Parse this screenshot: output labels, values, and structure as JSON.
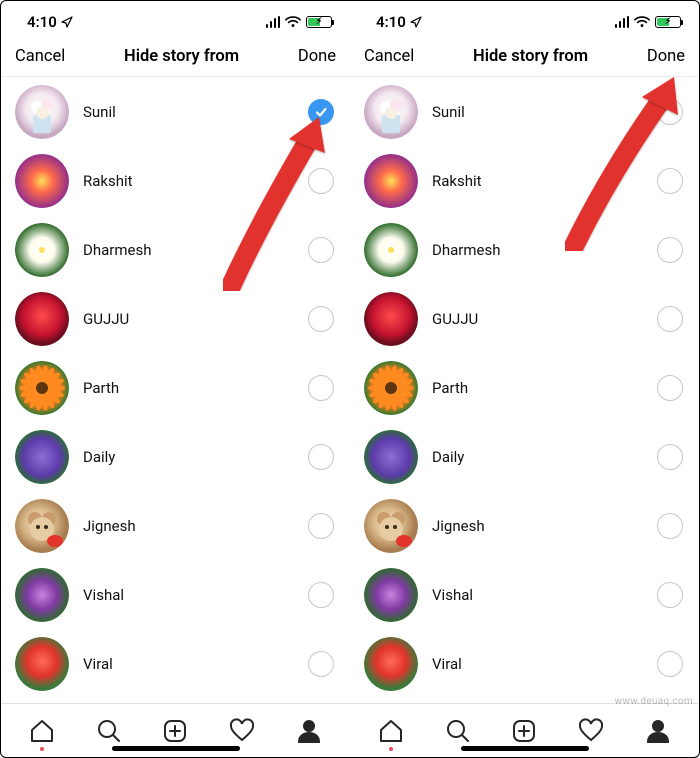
{
  "status": {
    "time": "4:10",
    "location_icon": "location-arrow"
  },
  "header": {
    "cancel": "Cancel",
    "title": "Hide story from",
    "done": "Done"
  },
  "screens": [
    {
      "users": [
        {
          "name": "Sunil",
          "selected": true,
          "avatar": "bouquet-white"
        },
        {
          "name": "Rakshit",
          "selected": false,
          "avatar": "bouquet-mixed"
        },
        {
          "name": "Dharmesh",
          "selected": false,
          "avatar": "plumeria"
        },
        {
          "name": "GUJJU",
          "selected": false,
          "avatar": "red-roses"
        },
        {
          "name": "Parth",
          "selected": false,
          "avatar": "gerbera-orange"
        },
        {
          "name": "Daily",
          "selected": false,
          "avatar": "hydrangea-purple"
        },
        {
          "name": "Jignesh",
          "selected": false,
          "avatar": "teddy-rose"
        },
        {
          "name": "Vishal",
          "selected": false,
          "avatar": "small-purple"
        },
        {
          "name": "Viral",
          "selected": false,
          "avatar": "geranium-red"
        }
      ],
      "arrow_target": "first-user-checkmark"
    },
    {
      "users": [
        {
          "name": "Sunil",
          "selected": false,
          "avatar": "bouquet-white"
        },
        {
          "name": "Rakshit",
          "selected": false,
          "avatar": "bouquet-mixed"
        },
        {
          "name": "Dharmesh",
          "selected": false,
          "avatar": "plumeria"
        },
        {
          "name": "GUJJU",
          "selected": false,
          "avatar": "red-roses"
        },
        {
          "name": "Parth",
          "selected": false,
          "avatar": "gerbera-orange"
        },
        {
          "name": "Daily",
          "selected": false,
          "avatar": "hydrangea-purple"
        },
        {
          "name": "Jignesh",
          "selected": false,
          "avatar": "teddy-rose"
        },
        {
          "name": "Vishal",
          "selected": false,
          "avatar": "small-purple"
        },
        {
          "name": "Viral",
          "selected": false,
          "avatar": "geranium-red"
        }
      ],
      "arrow_target": "done-button"
    }
  ],
  "tabs": [
    "home",
    "search",
    "add",
    "activity",
    "profile"
  ],
  "active_tab": "profile",
  "watermark": "www.deuaq.com"
}
